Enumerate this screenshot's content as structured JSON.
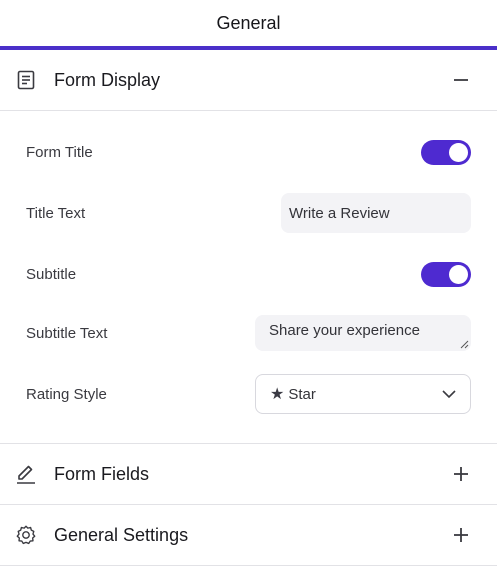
{
  "header": {
    "tab_label": "General",
    "accent_color": "#4a2fc9"
  },
  "sections": {
    "form_display": {
      "title": "Form Display",
      "icon": "document-icon",
      "expanded": true,
      "fields": {
        "form_title": {
          "label": "Form Title",
          "toggle_on": true
        },
        "title_text": {
          "label": "Title Text",
          "value": "Write a Review"
        },
        "subtitle": {
          "label": "Subtitle",
          "toggle_on": true
        },
        "subtitle_text": {
          "label": "Subtitle Text",
          "value": "Share your experience"
        },
        "rating_style": {
          "label": "Rating Style",
          "star_glyph": "★",
          "value": "Star"
        }
      }
    },
    "form_fields": {
      "title": "Form Fields",
      "icon": "pencil-icon",
      "expanded": false
    },
    "general_settings": {
      "title": "General Settings",
      "icon": "gear-icon",
      "expanded": false
    }
  }
}
